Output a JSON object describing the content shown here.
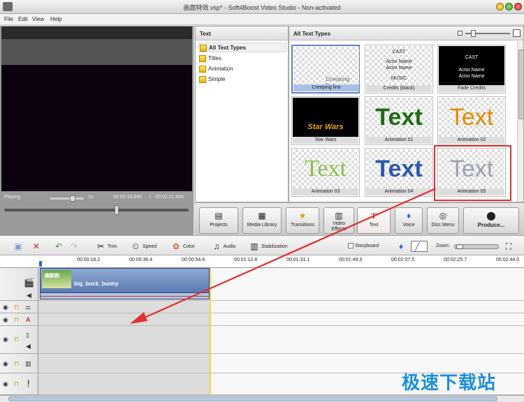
{
  "window": {
    "title": "画面特效.vsp* - Soft4Boost Video Studio - Non-activated"
  },
  "menu": [
    "File",
    "Edit",
    "View",
    "Help"
  ],
  "preview": {
    "status": "Playing",
    "speed": "1x",
    "time_current": "00:00:18.840",
    "time_total": "00:02:21.600"
  },
  "text_panel": {
    "header": "Text",
    "items": [
      {
        "label": "All Text Types",
        "selected": true
      },
      {
        "label": "Titles",
        "selected": false
      },
      {
        "label": "Animation",
        "selected": false
      },
      {
        "label": "Simple",
        "selected": false
      }
    ]
  },
  "gallery": {
    "header": "All Text Types",
    "tiles": [
      {
        "label": "Creeping line",
        "preview": "Creeping line",
        "selected": true
      },
      {
        "label": "Credits (black)",
        "preview": [
          "CAST",
          "Actor Name",
          "Actor Name",
          "MUSIC"
        ]
      },
      {
        "label": "Fade Credits",
        "preview": [
          "CAST",
          "Actor Name",
          "Actor Name"
        ]
      },
      {
        "label": "Star Wars",
        "preview": "Star Wars"
      },
      {
        "label": "Animation 01",
        "preview": "Text"
      },
      {
        "label": "Animation 02",
        "preview": "Text"
      },
      {
        "label": "Animation 03",
        "preview": "Text"
      },
      {
        "label": "Animation 04",
        "preview": "Text"
      },
      {
        "label": "Animation 05",
        "preview": "Text"
      }
    ]
  },
  "tabs": [
    {
      "label": "Projects",
      "icon": "projects-icon"
    },
    {
      "label": "Media Library",
      "icon": "media-library-icon"
    },
    {
      "label": "Transitions",
      "icon": "transitions-icon"
    },
    {
      "label": "Video Effects",
      "icon": "video-effects-icon"
    },
    {
      "label": "Text",
      "icon": "text-icon",
      "active": true
    },
    {
      "label": "Voice",
      "icon": "microphone-icon"
    },
    {
      "label": "Disc Menu",
      "icon": "disc-menu-icon"
    },
    {
      "label": "Produce...",
      "icon": "produce-icon"
    }
  ],
  "toolbar": {
    "trim": "Trim",
    "speed": "Speed",
    "color": "Color",
    "audio": "Audio",
    "stabilization": "Stabilization",
    "storyboard": "Storyboard",
    "zoom": "Zoom:"
  },
  "ruler": [
    "00:00:18.2",
    "00:00:36.4",
    "00:00:54.6",
    "00:01:12.8",
    "00:01:31.1",
    "00:01:49.3",
    "00:02:07.5",
    "00:02:25.7",
    "00:02:44.0"
  ],
  "timeline": {
    "clip_name": "big_buck_bunny",
    "thumb_caption": "幽默剧"
  },
  "watermark": "极速下载站",
  "colors": {
    "accent": "#2f66d0",
    "highlight": "#e03030",
    "playhead": "#ffd23a"
  }
}
